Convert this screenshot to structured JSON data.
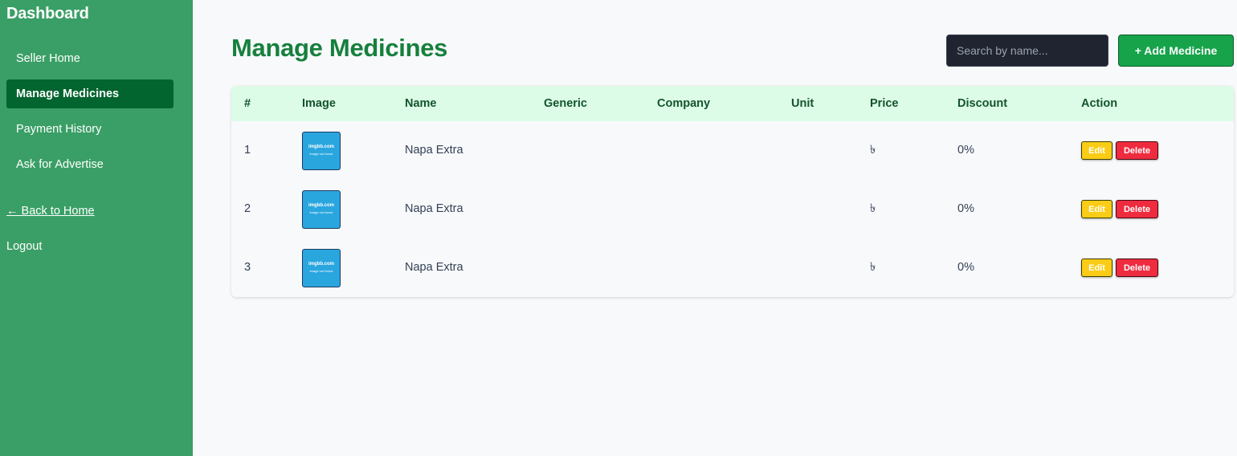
{
  "sidebar": {
    "brand": "Dashboard",
    "items": [
      {
        "label": "Seller Home",
        "active": false
      },
      {
        "label": "Manage Medicines",
        "active": true
      },
      {
        "label": "Payment History",
        "active": false
      },
      {
        "label": "Ask for Advertise",
        "active": false
      }
    ],
    "back_link": "← Back to Home",
    "logout": "Logout"
  },
  "header": {
    "title": "Manage Medicines",
    "search_placeholder": "Search by name...",
    "add_button": "+ Add Medicine"
  },
  "table": {
    "columns": [
      "#",
      "Image",
      "Name",
      "Generic",
      "Company",
      "Unit",
      "Price",
      "Discount",
      "Action"
    ],
    "rows": [
      {
        "index": "1",
        "image_line1": "imgbb.com",
        "image_line2": "image not found",
        "name": "Napa Extra",
        "generic": "",
        "company": "",
        "unit": "",
        "price": "৳",
        "discount": "0%",
        "edit": "Edit",
        "delete": "Delete"
      },
      {
        "index": "2",
        "image_line1": "imgbb.com",
        "image_line2": "image not found",
        "name": "Napa Extra",
        "generic": "",
        "company": "",
        "unit": "",
        "price": "৳",
        "discount": "0%",
        "edit": "Edit",
        "delete": "Delete"
      },
      {
        "index": "3",
        "image_line1": "imgbb.com",
        "image_line2": "image not found",
        "name": "Napa Extra",
        "generic": "",
        "company": "",
        "unit": "",
        "price": "৳",
        "discount": "0%",
        "edit": "Edit",
        "delete": "Delete"
      }
    ]
  },
  "colors": {
    "sidebar_bg": "#3a9f66",
    "active_item_bg": "#02642f",
    "title": "#16803d",
    "header_row_bg": "#dcfce7",
    "add_button_bg": "#16a34a",
    "edit_button_bg": "#facc15",
    "delete_button_bg": "#ef2b3f",
    "search_bg": "#1f2430"
  }
}
